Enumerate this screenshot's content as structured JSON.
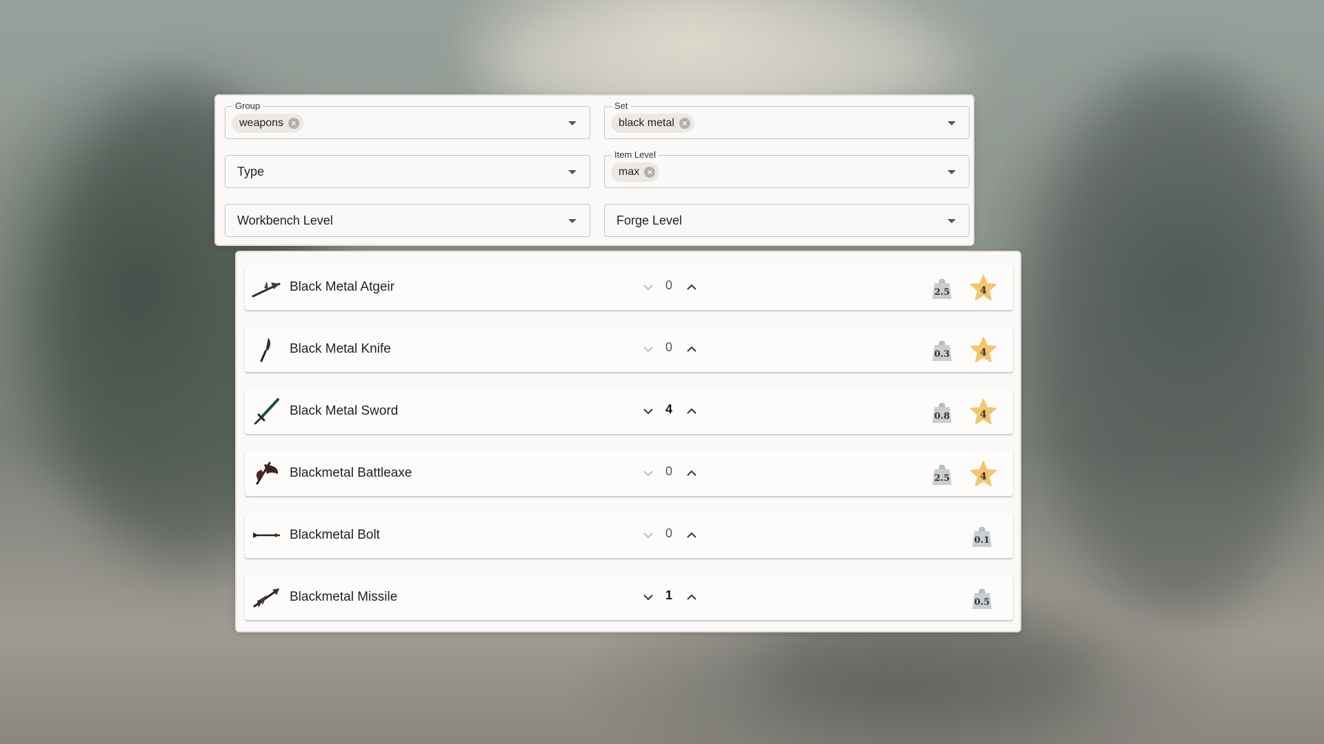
{
  "filters": {
    "group": {
      "label": "Group",
      "chip": "weapons"
    },
    "set": {
      "label": "Set",
      "chip": "black metal"
    },
    "type": {
      "placeholder": "Type"
    },
    "item_level": {
      "label": "Item Level",
      "chip": "max"
    },
    "workbench_level": {
      "placeholder": "Workbench Level"
    },
    "forge_level": {
      "placeholder": "Forge Level"
    }
  },
  "items": [
    {
      "name": "Black Metal Atgeir",
      "icon": "atgeir-icon",
      "qty": "0",
      "weight": "2.5",
      "level": "4"
    },
    {
      "name": "Black Metal Knife",
      "icon": "knife-icon",
      "qty": "0",
      "weight": "0.3",
      "level": "4"
    },
    {
      "name": "Black Metal Sword",
      "icon": "sword-icon",
      "qty": "4",
      "weight": "0.8",
      "level": "4"
    },
    {
      "name": "Blackmetal Battleaxe",
      "icon": "battleaxe-icon",
      "qty": "0",
      "weight": "2.5",
      "level": "4"
    },
    {
      "name": "Blackmetal Bolt",
      "icon": "bolt-icon",
      "qty": "0",
      "weight": "0.1",
      "level": ""
    },
    {
      "name": "Blackmetal Missile",
      "icon": "missile-icon",
      "qty": "1",
      "weight": "0.5",
      "level": ""
    }
  ],
  "colors": {
    "star": "#f6c46c",
    "weight": "#c9cfd1",
    "card": "#fbf9f7"
  }
}
